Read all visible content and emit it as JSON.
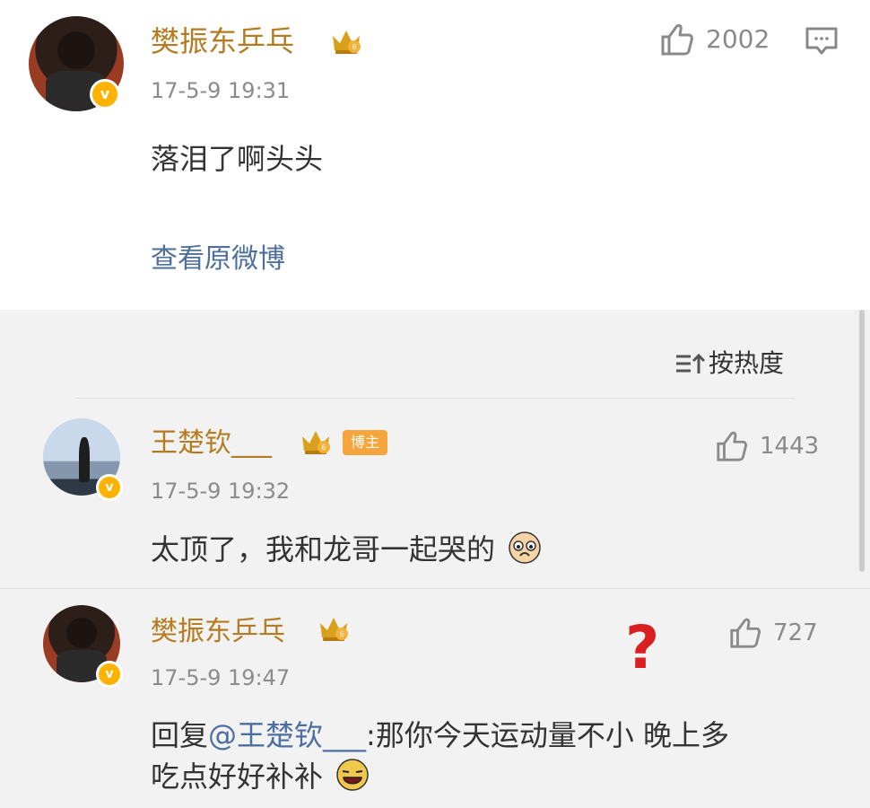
{
  "post": {
    "author": "樊振东乒乓",
    "time": "17-5-9 19:31",
    "likes": "2002",
    "content": "落泪了啊头头",
    "view_original": "查看原微博"
  },
  "sort": {
    "label": "按热度"
  },
  "comments": [
    {
      "author": "王楚钦___",
      "badge": "博主",
      "time": "17-5-9 19:32",
      "likes": "1443",
      "content": "太顶了，我和龙哥一起哭的"
    },
    {
      "author": "樊振东乒乓",
      "time": "17-5-9 19:47",
      "likes": "727",
      "reply_prefix": "回复",
      "mention": "@王楚钦___",
      "reply_text": ":那你今天运动量不小 晚上多",
      "reply_text_line2": "吃点好好补补"
    }
  ],
  "annotation": {
    "symbol": "?"
  },
  "icons": {
    "like": "thumbs-up-icon",
    "menu": "comment-menu-icon",
    "crown": "crown-badge-icon",
    "verified": "verified-badge-icon",
    "sort": "sort-icon"
  },
  "colors": {
    "name": "#b57b20",
    "link": "#4e6f9b",
    "verified": "#ffb300",
    "badge": "#f5a53b",
    "question": "#d91f1f"
  }
}
